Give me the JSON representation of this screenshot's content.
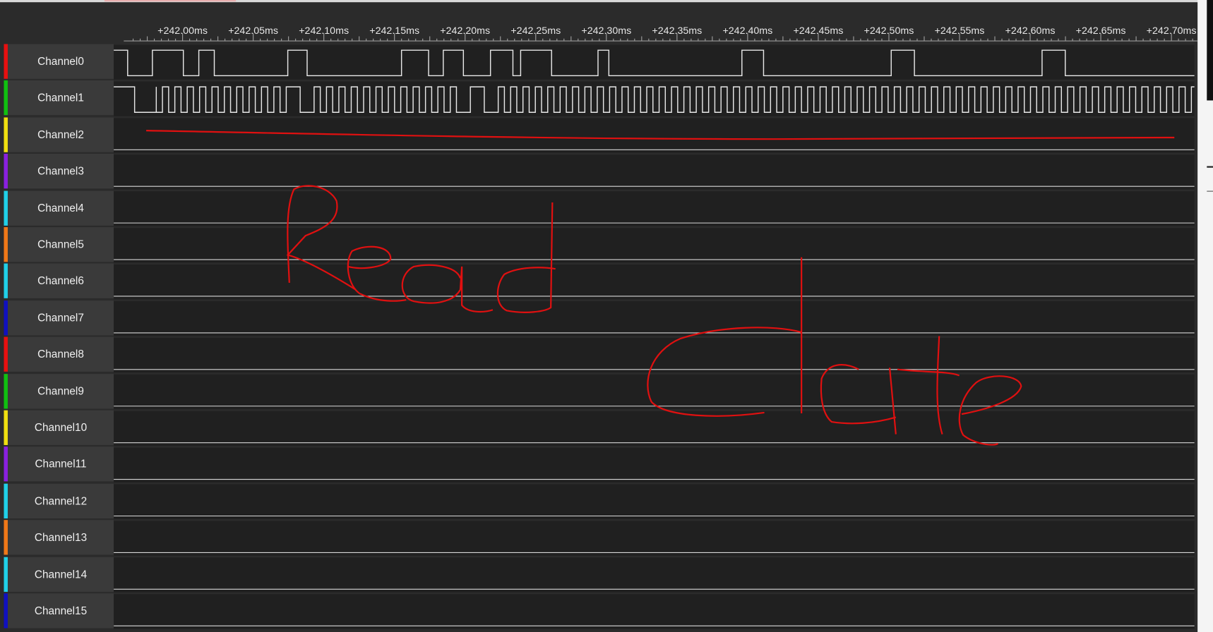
{
  "timeline": {
    "ticks": [
      "+242.00ms",
      "+242.05ms",
      "+242.10ms",
      "+242.15ms",
      "+242.20ms",
      "+242.25ms",
      "+242.30ms",
      "+242.35ms",
      "+242.40ms",
      "+242.45ms",
      "+242.50ms",
      "+242.55ms",
      "+242.60ms",
      "+242.65ms",
      "+242.70ms"
    ]
  },
  "channels": [
    {
      "label": "Channel0",
      "color": "#e81010"
    },
    {
      "label": "Channel1",
      "color": "#10c010"
    },
    {
      "label": "Channel2",
      "color": "#f0e010"
    },
    {
      "label": "Channel3",
      "color": "#8a20e0"
    },
    {
      "label": "Channel4",
      "color": "#20d0e8"
    },
    {
      "label": "Channel5",
      "color": "#f07818"
    },
    {
      "label": "Channel6",
      "color": "#20d0e8"
    },
    {
      "label": "Channel7",
      "color": "#1010c0"
    },
    {
      "label": "Channel8",
      "color": "#e81010"
    },
    {
      "label": "Channel9",
      "color": "#10c010"
    },
    {
      "label": "Channel10",
      "color": "#f0e010"
    },
    {
      "label": "Channel11",
      "color": "#8a20e0"
    },
    {
      "label": "Channel12",
      "color": "#20d0e8"
    },
    {
      "label": "Channel13",
      "color": "#f07818"
    },
    {
      "label": "Channel14",
      "color": "#20d0e8"
    },
    {
      "label": "Channel15",
      "color": "#1010c0"
    }
  ],
  "annotation": {
    "handwritten_text": [
      "Read",
      "data"
    ],
    "ink_color": "#e01010"
  }
}
